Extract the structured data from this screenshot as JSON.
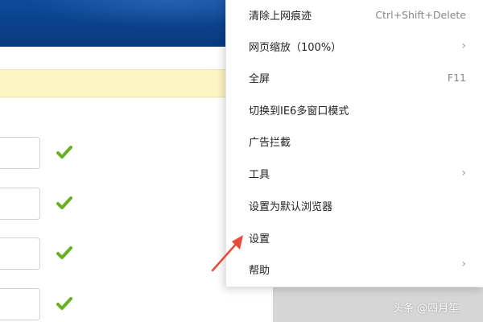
{
  "menu": {
    "items": [
      {
        "label": "清除上网痕迹",
        "shortcut": "Ctrl+Shift+Delete"
      },
      {
        "label": "网页缩放（100%）",
        "submenu": true
      },
      {
        "label": "全屏",
        "shortcut": "F11"
      },
      {
        "label": "切换到IE6多窗口模式"
      },
      {
        "label": "广告拦截"
      },
      {
        "label": "工具",
        "submenu": true
      },
      {
        "label": "设置为默认浏览器"
      },
      {
        "label": "设置"
      },
      {
        "label": "帮助",
        "submenu": true
      }
    ]
  },
  "watermark": "头条 @四月笙",
  "colors": {
    "banner": "#0a3f86",
    "notice_bg": "#fdf5c4",
    "check": "#6ab023",
    "arrow": "#e64b3c"
  },
  "icons": {
    "check": "green-check-icon",
    "submenu": "chevron-right-icon",
    "pointer": "red-arrow-icon"
  }
}
